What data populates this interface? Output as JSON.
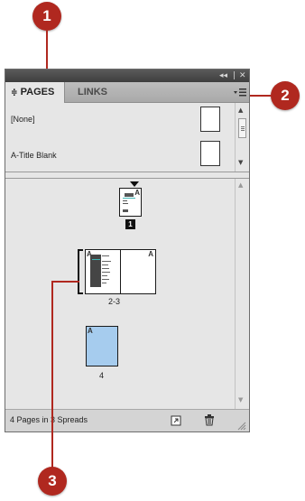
{
  "callouts": {
    "one": "1",
    "two": "2",
    "three": "3"
  },
  "panel": {
    "tabs": {
      "pages": "PAGES",
      "links": "LINKS"
    },
    "tab_collapse_glyph": "≑",
    "titlebar": {
      "collapse": "◂◂",
      "separator": "|",
      "close": "✕"
    },
    "masters": [
      {
        "label": "[None]"
      },
      {
        "label": "A-Title Blank"
      }
    ],
    "pages": [
      {
        "master_letter": "A",
        "number": "1",
        "current": true
      },
      {
        "spread_label": "2-3",
        "left_letter": "A",
        "right_letter": "A"
      },
      {
        "master_letter": "A",
        "number": "4"
      }
    ],
    "status": "4 Pages in 3 Spreads"
  },
  "colors": {
    "callout": "#b0281f",
    "page4_fill": "#a6ccee",
    "accent_teal": "#3fb5b5"
  }
}
